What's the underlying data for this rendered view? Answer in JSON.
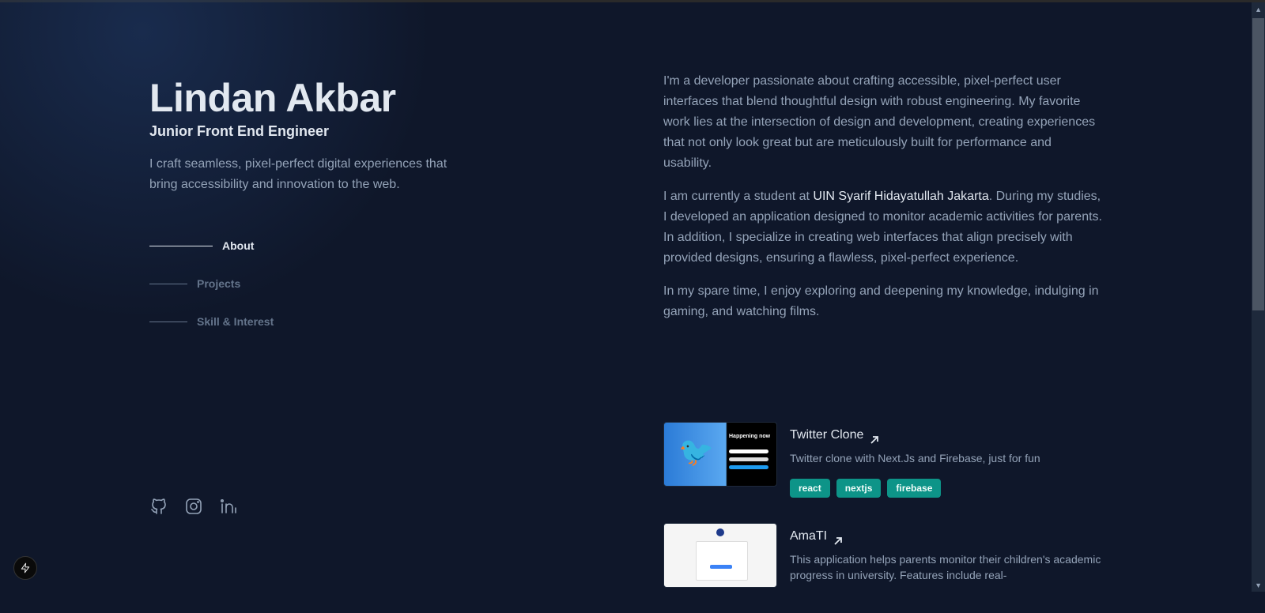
{
  "header": {
    "name": "Lindan Akbar",
    "role": "Junior Front End Engineer",
    "tagline": "I craft seamless, pixel-perfect digital experiences that bring accessibility and innovation to the web."
  },
  "nav": {
    "items": [
      {
        "label": "About",
        "active": true
      },
      {
        "label": "Projects",
        "active": false
      },
      {
        "label": "Skill & Interest",
        "active": false
      }
    ]
  },
  "socials": [
    {
      "icon": "github-icon"
    },
    {
      "icon": "instagram-icon"
    },
    {
      "icon": "linkedin-icon"
    }
  ],
  "about": {
    "p1": "I'm a developer passionate about crafting accessible, pixel-perfect user interfaces that blend thoughtful design with robust engineering. My favorite work lies at the intersection of design and development, creating experiences that not only look great but are meticulously built for performance and usability.",
    "p2_before": "I am currently a student at ",
    "p2_highlight": "UIN Syarif Hidayatullah Jakarta",
    "p2_after": ". During my studies, I developed an application designed to monitor academic activities for parents. In addition, I specialize in creating web interfaces that align precisely with provided designs, ensuring a flawless, pixel-perfect experience.",
    "p3": "In my spare time, I enjoy exploring and deepening my knowledge, indulging in gaming, and watching films."
  },
  "projects": [
    {
      "title": "Twitter Clone",
      "description": "Twitter clone with Next.Js and Firebase, just for fun",
      "tags": [
        "react",
        "nextjs",
        "firebase"
      ],
      "thumb_text": "Happening now"
    },
    {
      "title": "AmaTI",
      "description": "This application helps parents monitor their children's academic progress in university. Features include real-"
    }
  ],
  "colors": {
    "background": "#0f172a",
    "heading": "#e2e8f0",
    "body": "#94a3b8",
    "tag_bg": "#0d9488"
  }
}
